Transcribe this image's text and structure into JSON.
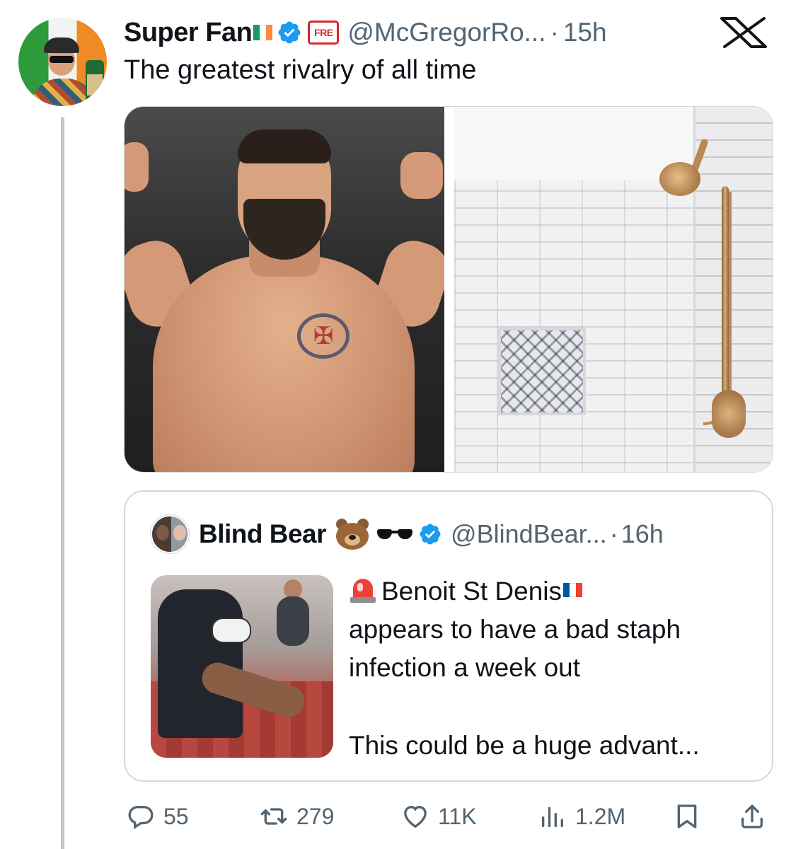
{
  "tweet": {
    "display_name": "Super Fan",
    "handle": "@McGregorRo...",
    "separator": "·",
    "time": "15h",
    "badge_text": "FRE",
    "text": "The greatest rivalry of all time",
    "avatar_icon": "super-fan-avatar",
    "flag_colors": [
      "#169b62",
      "#ffffff",
      "#ff883e"
    ],
    "verified_color": "#1d9bf0"
  },
  "quoted": {
    "display_name": "Blind Bear",
    "emojis": [
      "bear-icon",
      "sunglasses-icon"
    ],
    "handle": "@BlindBear...",
    "separator": "·",
    "time": "16h",
    "lines": [
      "Benoit St Denis",
      "appears to have a bad staph",
      "infection a week out",
      "This could be a huge advant..."
    ],
    "flag_colors": [
      "#0055a4",
      "#ffffff",
      "#ef4135"
    ]
  },
  "actions": {
    "replies": "55",
    "reposts": "279",
    "likes": "11K",
    "views": "1.2M"
  }
}
